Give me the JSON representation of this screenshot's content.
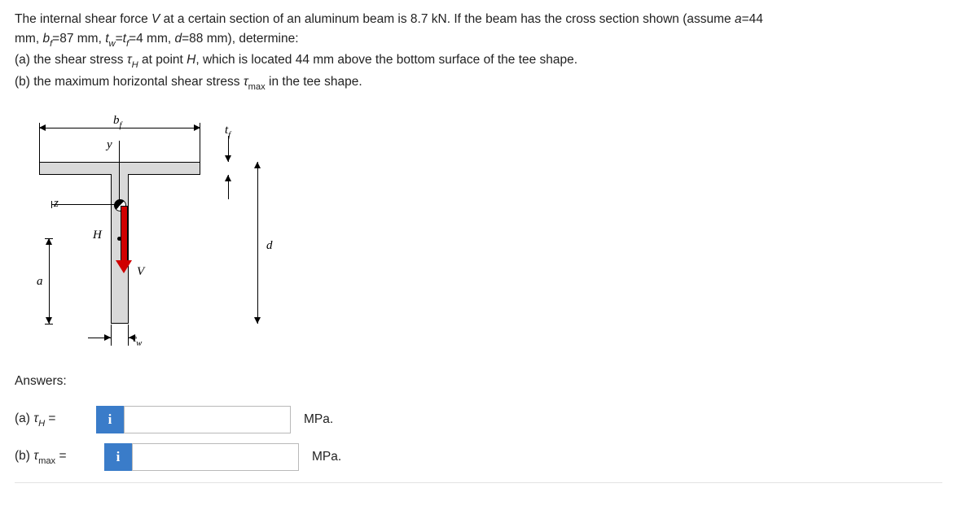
{
  "problem": {
    "line1_pre": "The internal shear force ",
    "V": "V",
    "line1_mid": " at a certain section of an aluminum beam is 8.7 kN. If the beam has the cross section shown (assume ",
    "a_eq": "a",
    "a_val": "=44",
    "line2_pre": "mm, ",
    "bf": "b",
    "bf_sub": "f",
    "bf_val": "=87 mm, ",
    "tw": "t",
    "tw_sub": "w",
    "eq": "=",
    "tf": "t",
    "tf_sub": "f",
    "twtf_val": "=4 mm, ",
    "d": "d",
    "d_val": "=88 mm), determine:",
    "part_a_pre": "(a) the shear stress ",
    "tau": "τ",
    "H_sub": "H",
    "part_a_post": " at point ",
    "H": "H",
    "part_a_end": ", which is located 44 mm above the bottom surface of the tee shape.",
    "part_b_pre": "(b) the maximum horizontal shear stress ",
    "max_sub": "max",
    "part_b_post": " in the tee shape."
  },
  "figure": {
    "bf": "b",
    "bf_sub": "f",
    "tf": "t",
    "tf_sub": "f",
    "tw": "t",
    "tw_sub": "w",
    "y": "y",
    "z": "z",
    "H": "H",
    "V": "V",
    "a": "a",
    "d": "d"
  },
  "answers": {
    "heading": "Answers:",
    "a_label_pre": "(a) ",
    "tau": "τ",
    "H_sub": "H",
    "eq": " =",
    "b_label_pre": "(b) ",
    "max_sub": "max",
    "info": "i",
    "unit": "MPa."
  }
}
